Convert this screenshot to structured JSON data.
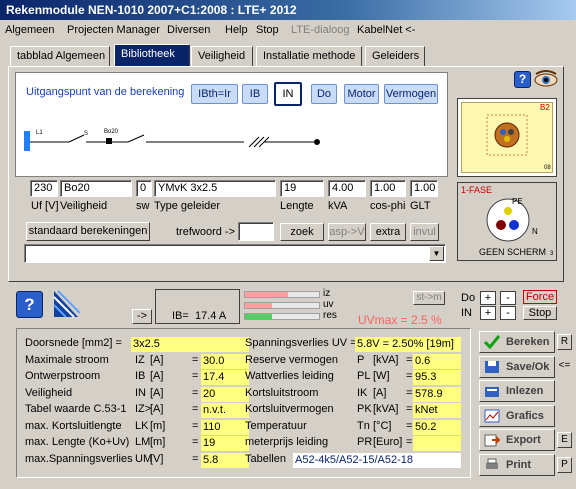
{
  "window": {
    "title": "Rekenmodule NEN-1010 2007+C1:2008 : LTE+ 2012"
  },
  "menu": [
    "Algemeen",
    "Projecten Manager",
    "Diversen",
    "Help",
    "Stop",
    "LTE-dialoog",
    "KabelNet <-"
  ],
  "tabs": [
    "tabblad Algemeen",
    "Bibliotheek",
    "Veiligheid",
    "Installatie methode",
    "Geleiders"
  ],
  "calc": {
    "heading": "Uitgangspunt van de berekening",
    "mode_buttons": [
      "IBth=Ir",
      "IB",
      "IN",
      "Do",
      "Motor",
      "Vermogen"
    ]
  },
  "diagram": {
    "left_label": "L1",
    "mid_label": "S",
    "breaker_label": "Bo20"
  },
  "fields": {
    "uf": "230",
    "veiligheid": "Bo20",
    "sw": "0",
    "type_geleider": "YMvK 3x2.5",
    "lengte": "19",
    "kva": "4.00",
    "cosphi": "1.00",
    "glt": "1.00"
  },
  "field_labels": {
    "uf": "Uf [V]",
    "veiligheid": "Veiligheid",
    "sw": "sw",
    "type": "Type geleider",
    "lengte": "Lengte",
    "kva": "kVA",
    "cosphi": "cos-phi",
    "glt": "GLT"
  },
  "search": {
    "std_button": "standaard berekeningen",
    "trefwoord": "trefwoord ->",
    "zoek": "zoek",
    "asp": "asp->V",
    "extra": "extra",
    "invul": "invul"
  },
  "side": {
    "b2": "B2",
    "b8": "08",
    "fase": "1-FASE",
    "pe": "PE",
    "n": "N",
    "geen_scherm": "GEEN SCHERM",
    "num": "3"
  },
  "status": {
    "arrow_btn": "->",
    "ib_text": "IB=",
    "ib_value": "17.4 A",
    "bars": [
      {
        "label": "iz",
        "fraction": 0.58,
        "color": "#ffa0a0"
      },
      {
        "label": "uv",
        "fraction": 0.36,
        "color": "#ffa0a0"
      },
      {
        "label": "res",
        "fraction": 0.36,
        "color": "#50d060"
      }
    ],
    "uvmax": "UVmax = 2.5 %",
    "stm": "st->m",
    "do": "Do",
    "in": "IN",
    "plus": "+",
    "minus": "-",
    "force": "Force",
    "stop": "Stop"
  },
  "results_left": [
    {
      "label": "Doorsnede [mm2]  =",
      "sym": "",
      "unit": "",
      "eq": "",
      "value": "3x2.5"
    },
    {
      "label": "Maximale stroom",
      "sym": "IZ",
      "unit": "[A]",
      "eq": "=",
      "value": "30.0"
    },
    {
      "label": "Ontwerpstroom",
      "sym": "IB",
      "unit": "[A]",
      "eq": "=",
      "value": "17.4"
    },
    {
      "label": "Veiligheid",
      "sym": "IN",
      "unit": "[A]",
      "eq": "=",
      "value": "20"
    },
    {
      "label": "Tabel waarde C.53-1",
      "sym": "IZ>",
      "unit": "[A]",
      "eq": "=",
      "value": "n.v.t."
    },
    {
      "label": "max. Kortsluitlengte",
      "sym": "LK",
      "unit": "[m]",
      "eq": "=",
      "value": "110"
    },
    {
      "label": "max. Lengte (Ko+Uv)",
      "sym": "LM",
      "unit": "[m]",
      "eq": "=",
      "value": "19"
    },
    {
      "label": "max.Spanningsverlies",
      "sym": "UM",
      "unit": "[V]",
      "eq": "=",
      "value": "5.8"
    }
  ],
  "results_right": [
    {
      "label": "Spanningsverlies UV =",
      "sym": "",
      "unit": "",
      "eq": "",
      "value": "5.8V = 2.50% [19m]"
    },
    {
      "label": "Reserve vermogen",
      "sym": "P",
      "unit": "[kVA]",
      "eq": "=",
      "value": "0.6"
    },
    {
      "label": "Wattverlies leiding",
      "sym": "PL",
      "unit": "[W]",
      "eq": "=",
      "value": "95.3"
    },
    {
      "label": "Kortsluitstroom",
      "sym": "IK",
      "unit": "[A]",
      "eq": "=",
      "value": "578.9"
    },
    {
      "label": "Kortsluitvermogen",
      "sym": "PK",
      "unit": "[kVA]",
      "eq": "=",
      "value": "kNet"
    },
    {
      "label": "Temperatuur",
      "sym": "Tn",
      "unit": "[°C]",
      "eq": "=",
      "value": "50.2"
    },
    {
      "label": "meterprijs leiding",
      "sym": "PR",
      "unit": "[Euro]",
      "eq": "=",
      "value": ""
    },
    {
      "label": "Tabellen",
      "sym": "",
      "unit": "",
      "eq": "",
      "value": "A52-4k5/A52-15/A52-18"
    }
  ],
  "actions": [
    {
      "label": "Bereken",
      "key": "R"
    },
    {
      "label": "Save/Ok",
      "key": "<="
    },
    {
      "label": "Inlezen",
      "key": ""
    },
    {
      "label": "Grafics",
      "key": ""
    },
    {
      "label": "Export",
      "key": "E"
    },
    {
      "label": "Print",
      "key": "P"
    }
  ]
}
